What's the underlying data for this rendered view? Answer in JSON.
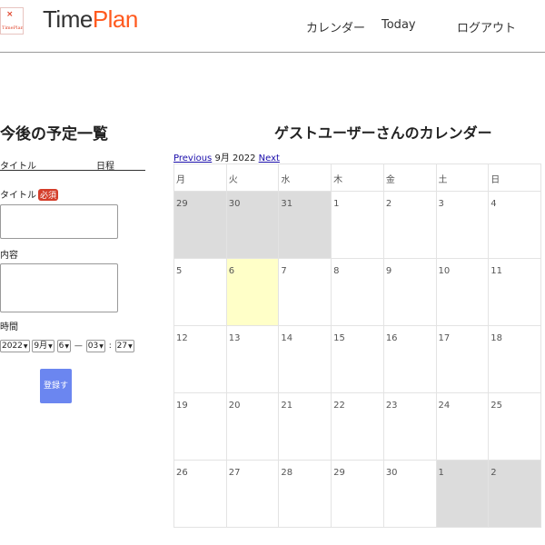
{
  "header": {
    "logo_glyph": "×",
    "logo_text": "TimePlan",
    "brand_part1": "Time",
    "brand_part2": "Plan",
    "nav": {
      "calendar": "カレンダー",
      "today": "Today",
      "logout": "ログアウト"
    }
  },
  "upcoming": {
    "title": "今後の予定一覧",
    "col_title": "タイトル",
    "col_date": "日程"
  },
  "form": {
    "title_label": "タイトル",
    "required_badge": "必須",
    "content_label": "内容",
    "time_label": "時間",
    "year": "2022",
    "month": "9月",
    "day": "6",
    "dash": "—",
    "hour": "03",
    "colon": ":",
    "minute": "27",
    "submit_label": "登録する"
  },
  "calendar": {
    "title": "ゲストユーザーさんのカレンダー",
    "prev_label": "Previous",
    "month_label": "9月 2022",
    "next_label": "Next",
    "weekdays": [
      "月",
      "火",
      "水",
      "木",
      "金",
      "土",
      "日"
    ],
    "weeks": [
      [
        {
          "day": "29",
          "other": true
        },
        {
          "day": "30",
          "other": true
        },
        {
          "day": "31",
          "other": true
        },
        {
          "day": "1"
        },
        {
          "day": "2"
        },
        {
          "day": "3"
        },
        {
          "day": "4"
        }
      ],
      [
        {
          "day": "5"
        },
        {
          "day": "6",
          "today": true
        },
        {
          "day": "7"
        },
        {
          "day": "8"
        },
        {
          "day": "9"
        },
        {
          "day": "10"
        },
        {
          "day": "11"
        }
      ],
      [
        {
          "day": "12"
        },
        {
          "day": "13"
        },
        {
          "day": "14"
        },
        {
          "day": "15"
        },
        {
          "day": "16"
        },
        {
          "day": "17"
        },
        {
          "day": "18"
        }
      ],
      [
        {
          "day": "19"
        },
        {
          "day": "20"
        },
        {
          "day": "21"
        },
        {
          "day": "22"
        },
        {
          "day": "23"
        },
        {
          "day": "24"
        },
        {
          "day": "25"
        }
      ],
      [
        {
          "day": "26"
        },
        {
          "day": "27"
        },
        {
          "day": "28"
        },
        {
          "day": "29"
        },
        {
          "day": "30"
        },
        {
          "day": "1",
          "other": true
        },
        {
          "day": "2",
          "other": true
        }
      ]
    ]
  },
  "colors": {
    "brand_accent": "#ff5a1f",
    "required_badge": "#d43d2a",
    "submit_button": "#6b86f0",
    "today_cell": "#ffffc8",
    "other_month_cell": "#dcdcdc"
  }
}
